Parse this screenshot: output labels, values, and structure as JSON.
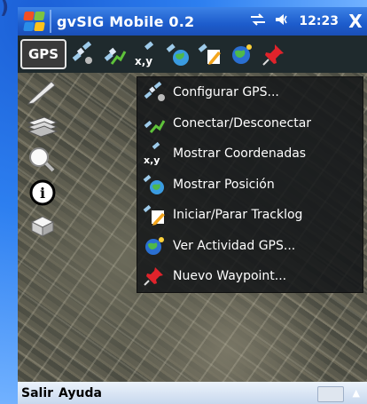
{
  "window": {
    "title": "gvSIG Mobile 0.2",
    "time": "12:23",
    "close": "X"
  },
  "toolbar": {
    "gps_label": "GPS"
  },
  "menu": {
    "items": [
      {
        "label": "Configurar GPS...",
        "icon": "satellite-wrench-icon"
      },
      {
        "label": "Conectar/Desconectar",
        "icon": "satellite-connect-icon"
      },
      {
        "label": "Mostrar Coordenadas",
        "icon": "satellite-xy-icon"
      },
      {
        "label": "Mostrar Posición",
        "icon": "satellite-globe-icon"
      },
      {
        "label": "Iniciar/Parar Tracklog",
        "icon": "satellite-pencil-icon"
      },
      {
        "label": "Ver Actividad GPS...",
        "icon": "globe-activity-icon"
      },
      {
        "label": "Nuevo Waypoint...",
        "icon": "pushpin-icon"
      }
    ]
  },
  "bottombar": {
    "left_softkey": "Salir",
    "right_softkey": "Ayuda"
  },
  "colors": {
    "titlebar": "#1d5ccc",
    "toolbar": "#1f2a2d",
    "menu_bg": "#141618",
    "accent_red": "#e0232b"
  }
}
